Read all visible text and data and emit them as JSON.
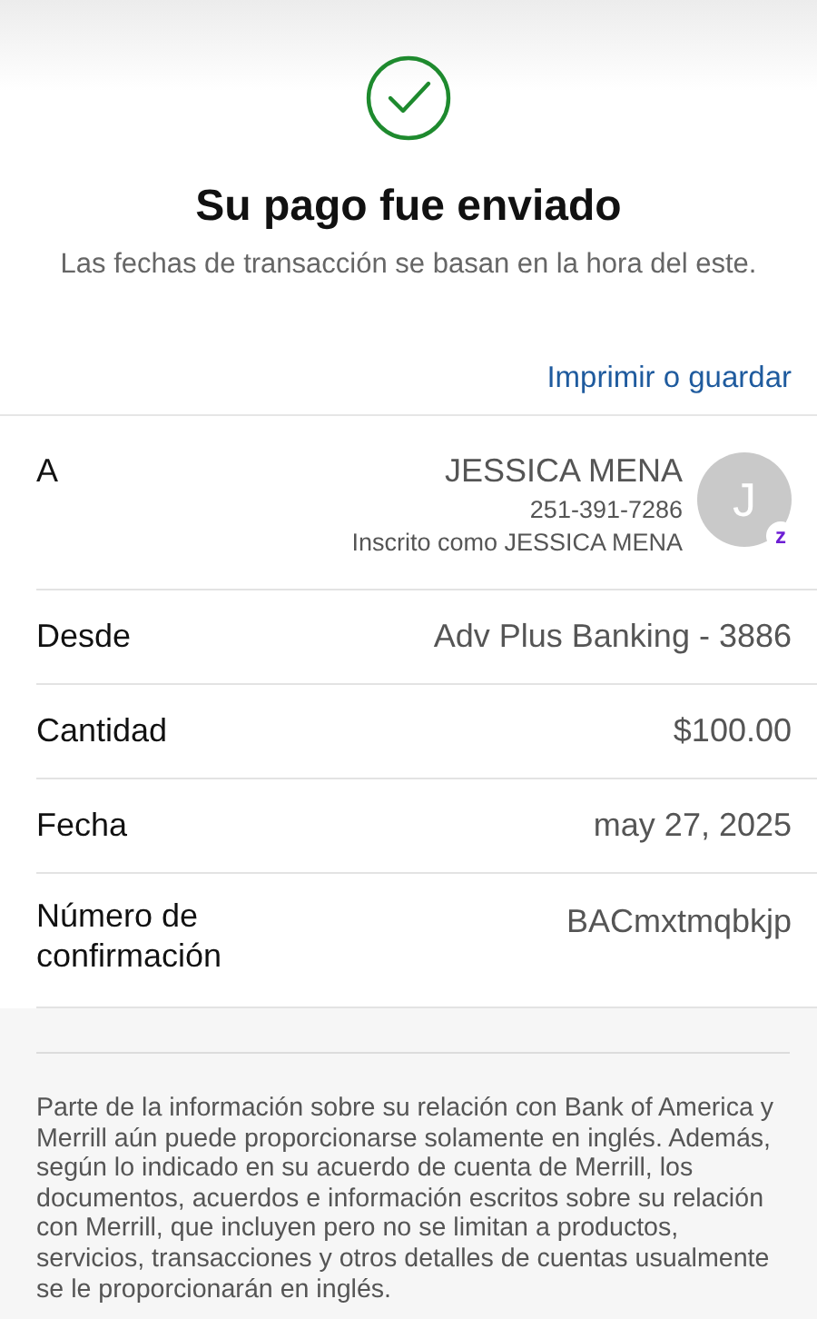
{
  "header": {
    "title": "Su pago fue enviado",
    "subtitle": "Las fechas de transacción se basan en la hora del este.",
    "link": "Imprimir o guardar"
  },
  "rows": [
    {
      "kind": "recipient",
      "label": "A",
      "name": "JESSICA MENA",
      "phone": "251-391-7286",
      "enrolled": "Inscrito como JESSICA MENA",
      "initial": "J",
      "badge": "z"
    },
    {
      "kind": "simple",
      "label": "Desde",
      "value": "Adv Plus Banking - 3886"
    },
    {
      "kind": "simple",
      "label": "Cantidad",
      "value": "$100.00"
    },
    {
      "kind": "simple",
      "label": "Fecha",
      "value": "may 27, 2025"
    },
    {
      "kind": "simple",
      "label": "Número de confirmación",
      "value": "BACmxtmqbkjp"
    }
  ],
  "disclaimer": "Parte de la información sobre su relación con Bank of America y Merrill aún puede proporcionarse solamente en inglés. Además, según lo indicado en su acuerdo de cuenta de Merrill, los documentos, acuerdos e información escritos sobre su relación con Merrill, que incluyen pero no se limitan a productos, servicios, transacciones y otros detalles de cuentas usualmente se le proporcionarán en inglés."
}
